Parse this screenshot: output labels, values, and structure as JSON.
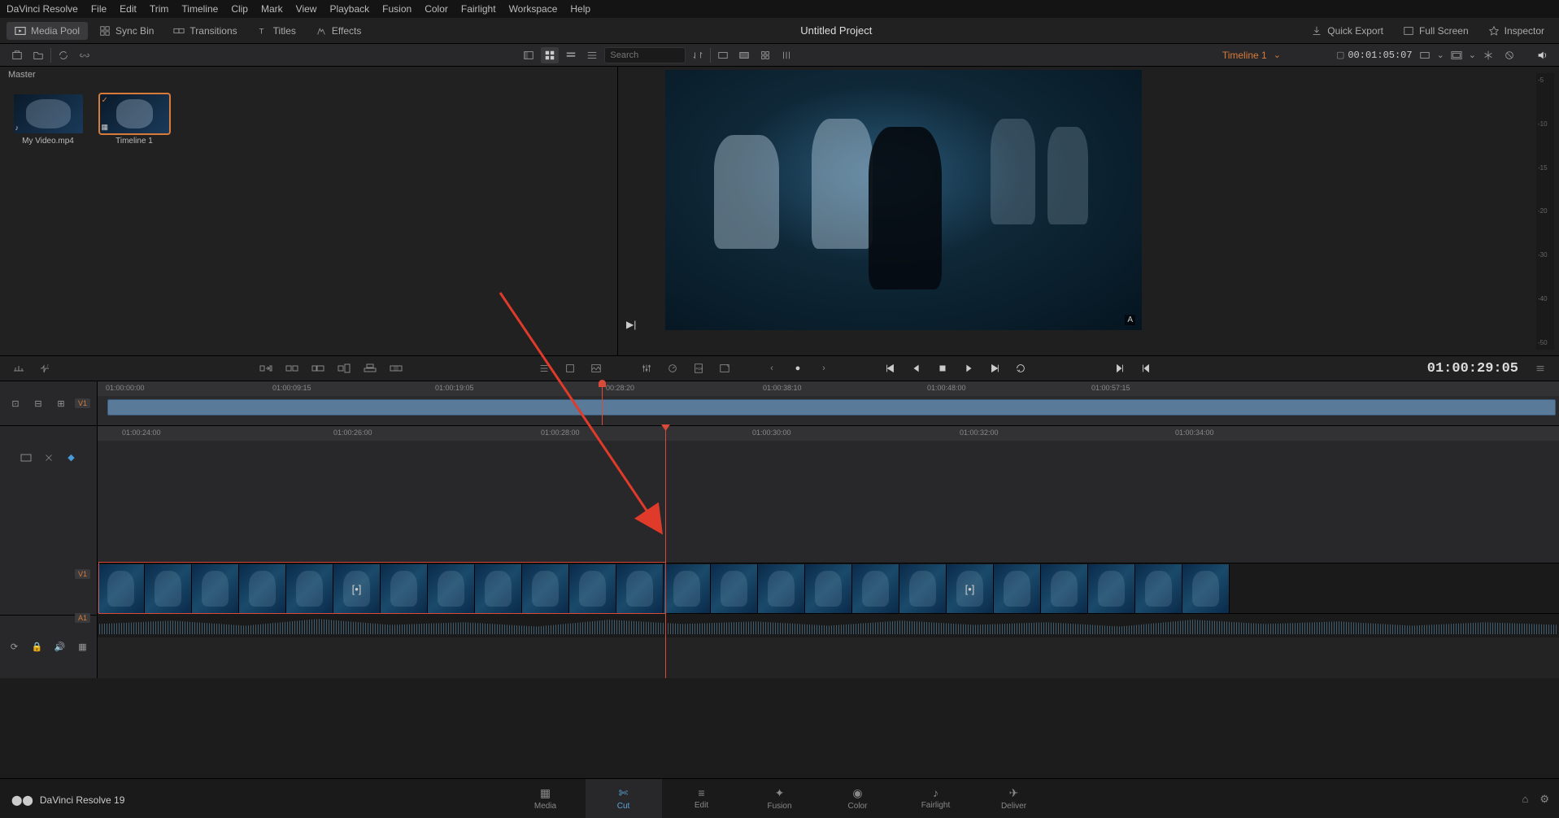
{
  "menubar": [
    "DaVinci Resolve",
    "File",
    "Edit",
    "Trim",
    "Timeline",
    "Clip",
    "Mark",
    "View",
    "Playback",
    "Fusion",
    "Color",
    "Fairlight",
    "Workspace",
    "Help"
  ],
  "toolbar": {
    "media_pool": "Media Pool",
    "sync_bin": "Sync Bin",
    "transitions": "Transitions",
    "titles": "Titles",
    "effects": "Effects",
    "project_title": "Untitled Project",
    "quick_export": "Quick Export",
    "full_screen": "Full Screen",
    "inspector": "Inspector"
  },
  "secondary": {
    "search_placeholder": "Search",
    "timeline_name": "Timeline 1",
    "timecode": "00:01:05:07"
  },
  "media": {
    "master": "Master",
    "items": [
      {
        "label": "My Video.mp4",
        "kind": "clip"
      },
      {
        "label": "Timeline 1",
        "kind": "timeline"
      }
    ]
  },
  "transport": {
    "big_timecode": "01:00:29:05"
  },
  "upper_ruler": [
    "01:00:00:00",
    "01:00:09:15",
    "01:00:19:05",
    "00:28:20",
    "01:00:38:10",
    "01:00:48:00",
    "01:00:57:15"
  ],
  "lower_ruler": [
    "01:00:24:00",
    "01:00:26:00",
    "01:00:28:00",
    "01:00:30:00",
    "01:00:32:00",
    "01:00:34:00"
  ],
  "tracks": {
    "v1": "V1",
    "a1": "A1"
  },
  "meter_marks": [
    "-5",
    "-10",
    "-15",
    "-20",
    "-30",
    "-40",
    "-50"
  ],
  "pages": [
    "Media",
    "Cut",
    "Edit",
    "Fusion",
    "Color",
    "Fairlight",
    "Deliver"
  ],
  "version": "DaVinci Resolve 19"
}
